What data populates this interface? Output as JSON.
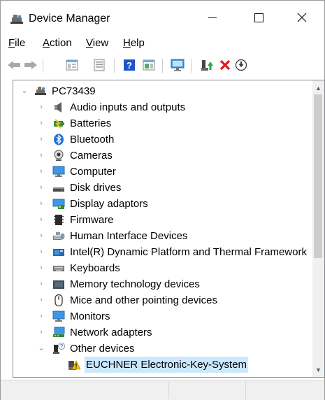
{
  "window": {
    "title": "Device Manager",
    "controls": {
      "minimize": "—",
      "maximize": "☐",
      "close": "✕"
    }
  },
  "menu": [
    {
      "key": "F",
      "rest": "ile"
    },
    {
      "key": "A",
      "rest": "ction"
    },
    {
      "key": "V",
      "rest": "iew"
    },
    {
      "key": "H",
      "rest": "elp"
    }
  ],
  "toolbar": {
    "buttons": [
      "back-icon",
      "forward-icon",
      "properties-pane-icon",
      "properties-icon",
      "help-icon",
      "action-pane-icon",
      "scan-hardware-icon",
      "update-driver-icon",
      "uninstall-icon",
      "disable-icon"
    ]
  },
  "tree": {
    "root": "PC73439",
    "items": [
      "Audio inputs and outputs",
      "Batteries",
      "Bluetooth",
      "Cameras",
      "Computer",
      "Disk drives",
      "Display adaptors",
      "Firmware",
      "Human Interface Devices",
      "Intel(R) Dynamic Platform and Thermal Framework",
      "Keyboards",
      "Memory technology devices",
      "Mice and other pointing devices",
      "Monitors",
      "Network adapters",
      "Other devices"
    ],
    "child_of_other_devices": "EUCHNER Electronic-Key-System"
  },
  "colors": {
    "selection": "#cce8ff",
    "error_red": "#e81123",
    "help_blue": "#1f56c7"
  }
}
